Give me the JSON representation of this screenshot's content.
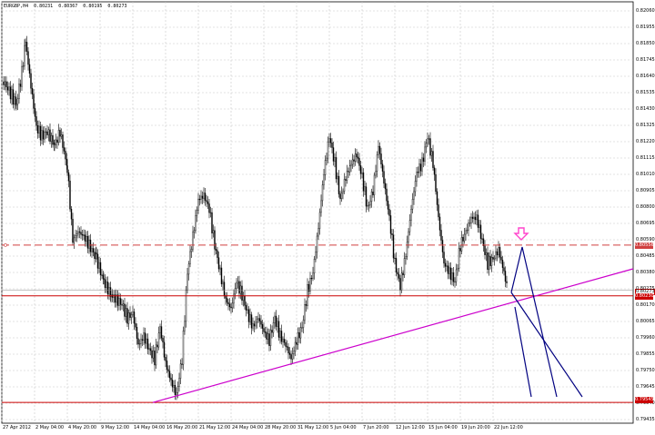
{
  "window": {
    "symbol": "EURGBP,H4",
    "ohlc": [
      "0.80231",
      "0.80367",
      "0.80195",
      "0.80273"
    ]
  },
  "price_axis": {
    "labels": [
      "0.82060",
      "0.81955",
      "0.81850",
      "0.81745",
      "0.81640",
      "0.81535",
      "0.81430",
      "0.81325",
      "0.81220",
      "0.81115",
      "0.81010",
      "0.80905",
      "0.80800",
      "0.80695",
      "0.80590",
      "0.80485",
      "0.80380",
      "0.80275",
      "0.80170",
      "0.80065",
      "0.79960",
      "0.79855",
      "0.79750",
      "0.79645",
      "0.79540",
      "0.79435"
    ]
  },
  "time_axis": {
    "labels": [
      "27 Apr 2012",
      "2 May 04:00",
      "4 May 20:00",
      "9 May 12:00",
      "14 May 04:00",
      "16 May 20:00",
      "21 May 12:00",
      "24 May 04:00",
      "28 May 20:00",
      "31 May 12:00",
      "5 Jun 04:00",
      "7 Jun 20:00",
      "12 Jun 12:00",
      "15 Jun 04:00",
      "19 Jun 20:00",
      "22 Jun 12:00"
    ]
  },
  "price_tags": {
    "dashed_level": "0.80556",
    "current_price": "0.80273",
    "level_upper": "0.80230",
    "level_lower": "0.79545"
  },
  "colors": {
    "background": "#ffffff",
    "grid": "#c8c8c8",
    "candles": "#000000",
    "support_resistance": "#cc0000",
    "dashed_level": "#d04040",
    "trendline": "#cc00cc",
    "projection": "#000080",
    "arrow": "#ff44cc"
  },
  "icons": {
    "arrow": "down-arrow-icon"
  }
}
